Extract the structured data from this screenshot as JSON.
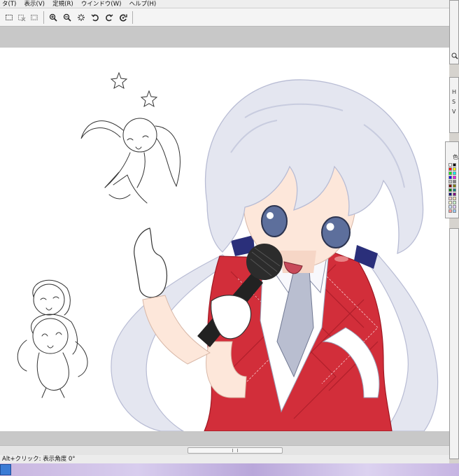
{
  "menu": [
    "タ(T)",
    "表示(V)",
    "定規(R)",
    "ウインドウ(W)",
    "ヘルプ(H)"
  ],
  "toolbar": {
    "tools": [
      "select-rect-icon",
      "deselect-icon",
      "invert-selection-icon",
      "zoom-in-icon",
      "zoom-out-icon",
      "reset-zoom-icon",
      "rotate-left-icon",
      "rotate-right-icon",
      "reset-rotation-icon"
    ]
  },
  "status": {
    "hint": "Alt+クリック: 表示角度 0°"
  },
  "panels": {
    "info_labels": [
      "H",
      "S",
      "V"
    ],
    "color_label": "色",
    "swatches": [
      "#ffffff",
      "#000000",
      "#ff0000",
      "#ffff00",
      "#00ff00",
      "#00ffff",
      "#0000ff",
      "#ff00ff",
      "#c0c0c0",
      "#808080",
      "#800000",
      "#808000",
      "#008000",
      "#008080",
      "#000080",
      "#800080",
      "#ffcccc",
      "#ffe0b0",
      "#ffffcc",
      "#ccffcc",
      "#cce0ff",
      "#e0ccff",
      "#ff9999",
      "#99ccff"
    ]
  },
  "colors": {
    "hair": "#e4e6f0",
    "hair_shade": "#b8bcd4",
    "skin": "#fde7da",
    "eye": "#5d6f9c",
    "vest": "#d22e3a",
    "vest_dark": "#9d1823",
    "ribbon": "#2a2f7a",
    "mic": "#222222"
  }
}
